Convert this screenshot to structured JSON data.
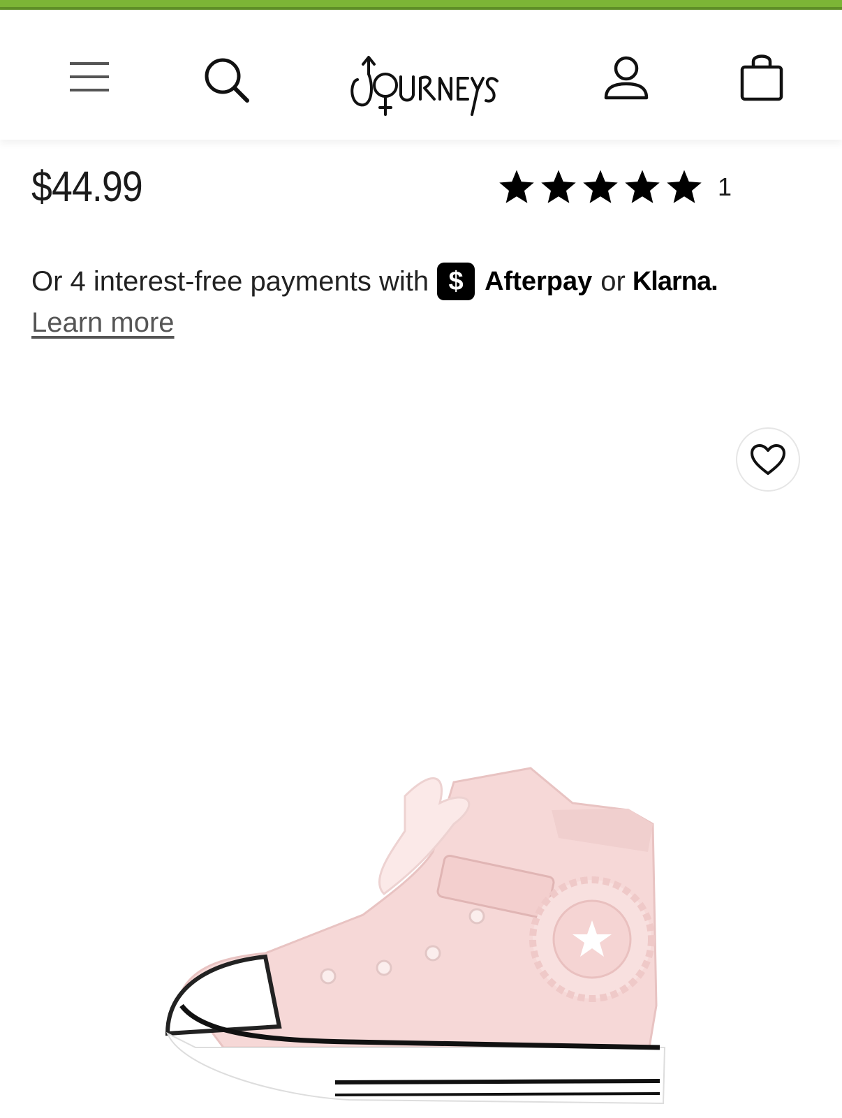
{
  "header": {
    "brand": "JOURNEYS",
    "icons": {
      "menu": "hamburger-menu-icon",
      "search": "search-icon",
      "account": "user-icon",
      "cart": "shopping-bag-icon"
    },
    "accent_color": "#7cb536"
  },
  "product": {
    "price": "$44.99",
    "rating": {
      "stars": 5,
      "max": 5,
      "count": "1"
    },
    "favorite_icon": "heart-icon",
    "image_alt": "Pink high-top sneaker with satin bow and ruffled ankle patch"
  },
  "payments": {
    "text": "Or 4 interest-free payments with",
    "cashapp_glyph": "$",
    "afterpay_label": "Afterpay",
    "or_label": "or",
    "klarna_label": "Klarna.",
    "learn_more": "Learn more"
  }
}
